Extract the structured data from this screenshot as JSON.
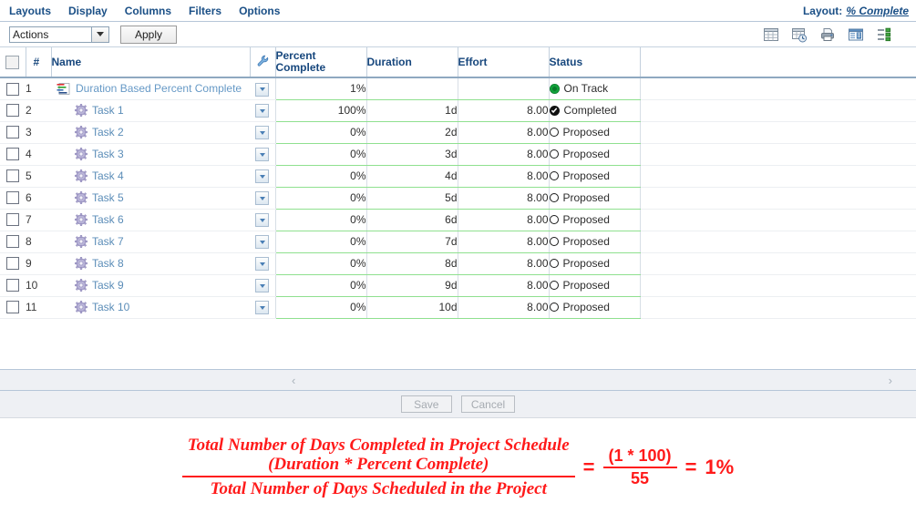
{
  "menu": {
    "items": [
      "Layouts",
      "Display",
      "Columns",
      "Filters",
      "Options"
    ],
    "layout_label": "Layout:",
    "layout_value": "% Complete"
  },
  "actionbar": {
    "action_select_value": "Actions",
    "apply_label": "Apply",
    "tool_icons": [
      "grid-icon",
      "grid-clock-icon",
      "printer-icon",
      "report-icon",
      "list-detail-icon"
    ]
  },
  "grid": {
    "columns": [
      {
        "key": "check",
        "label": ""
      },
      {
        "key": "num",
        "label": "#"
      },
      {
        "key": "name",
        "label": "Name"
      },
      {
        "key": "wrench",
        "label": ""
      },
      {
        "key": "pct",
        "label": "Percent Complete"
      },
      {
        "key": "dur",
        "label": "Duration"
      },
      {
        "key": "eff",
        "label": "Effort"
      },
      {
        "key": "sts",
        "label": "Status"
      },
      {
        "key": "tail",
        "label": ""
      }
    ],
    "header_pct_line1": "Percent",
    "header_pct_line2": "Complete",
    "rows": [
      {
        "num": "1",
        "name": "Duration Based Percent Complete",
        "icon": "project-icon",
        "pct": "1%",
        "dur": "",
        "eff": "",
        "status": "On Track",
        "status_icon": "ontrack-dot-icon"
      },
      {
        "num": "2",
        "name": "Task 1",
        "icon": "task-gear-icon",
        "pct": "100%",
        "dur": "1d",
        "eff": "8.00",
        "status": "Completed",
        "status_icon": "completed-check-icon"
      },
      {
        "num": "3",
        "name": "Task 2",
        "icon": "task-gear-icon",
        "pct": "0%",
        "dur": "2d",
        "eff": "8.00",
        "status": "Proposed",
        "status_icon": "proposed-circle-icon"
      },
      {
        "num": "4",
        "name": "Task 3",
        "icon": "task-gear-icon",
        "pct": "0%",
        "dur": "3d",
        "eff": "8.00",
        "status": "Proposed",
        "status_icon": "proposed-circle-icon"
      },
      {
        "num": "5",
        "name": "Task 4",
        "icon": "task-gear-icon",
        "pct": "0%",
        "dur": "4d",
        "eff": "8.00",
        "status": "Proposed",
        "status_icon": "proposed-circle-icon"
      },
      {
        "num": "6",
        "name": "Task 5",
        "icon": "task-gear-icon",
        "pct": "0%",
        "dur": "5d",
        "eff": "8.00",
        "status": "Proposed",
        "status_icon": "proposed-circle-icon"
      },
      {
        "num": "7",
        "name": "Task 6",
        "icon": "task-gear-icon",
        "pct": "0%",
        "dur": "6d",
        "eff": "8.00",
        "status": "Proposed",
        "status_icon": "proposed-circle-icon"
      },
      {
        "num": "8",
        "name": "Task 7",
        "icon": "task-gear-icon",
        "pct": "0%",
        "dur": "7d",
        "eff": "8.00",
        "status": "Proposed",
        "status_icon": "proposed-circle-icon"
      },
      {
        "num": "9",
        "name": "Task 8",
        "icon": "task-gear-icon",
        "pct": "0%",
        "dur": "8d",
        "eff": "8.00",
        "status": "Proposed",
        "status_icon": "proposed-circle-icon"
      },
      {
        "num": "10",
        "name": "Task 9",
        "icon": "task-gear-icon",
        "pct": "0%",
        "dur": "9d",
        "eff": "8.00",
        "status": "Proposed",
        "status_icon": "proposed-circle-icon"
      },
      {
        "num": "11",
        "name": "Task 10",
        "icon": "task-gear-icon",
        "pct": "0%",
        "dur": "10d",
        "eff": "8.00",
        "status": "Proposed",
        "status_icon": "proposed-circle-icon"
      }
    ]
  },
  "scrollbar": {
    "left_arrow": "‹",
    "right_arrow": "›"
  },
  "footer": {
    "save_label": "Save",
    "cancel_label": "Cancel"
  },
  "formula": {
    "numerator_line1": "Total Number of Days Completed in Project Schedule",
    "numerator_line2": "(Duration * Percent Complete)",
    "denominator": "Total Number of Days Scheduled in the Project",
    "equals1": "=",
    "calc_numerator": "(1 * 100)",
    "calc_denominator": "55",
    "equals2": "=",
    "result": "1%",
    "color": "#ff1a1a"
  },
  "colors": {
    "menu_text": "#1a4f86",
    "header_text": "#17477d",
    "link": "#5b8db8",
    "green_border": "#8fe08f",
    "ontrack": "#11a03a"
  }
}
